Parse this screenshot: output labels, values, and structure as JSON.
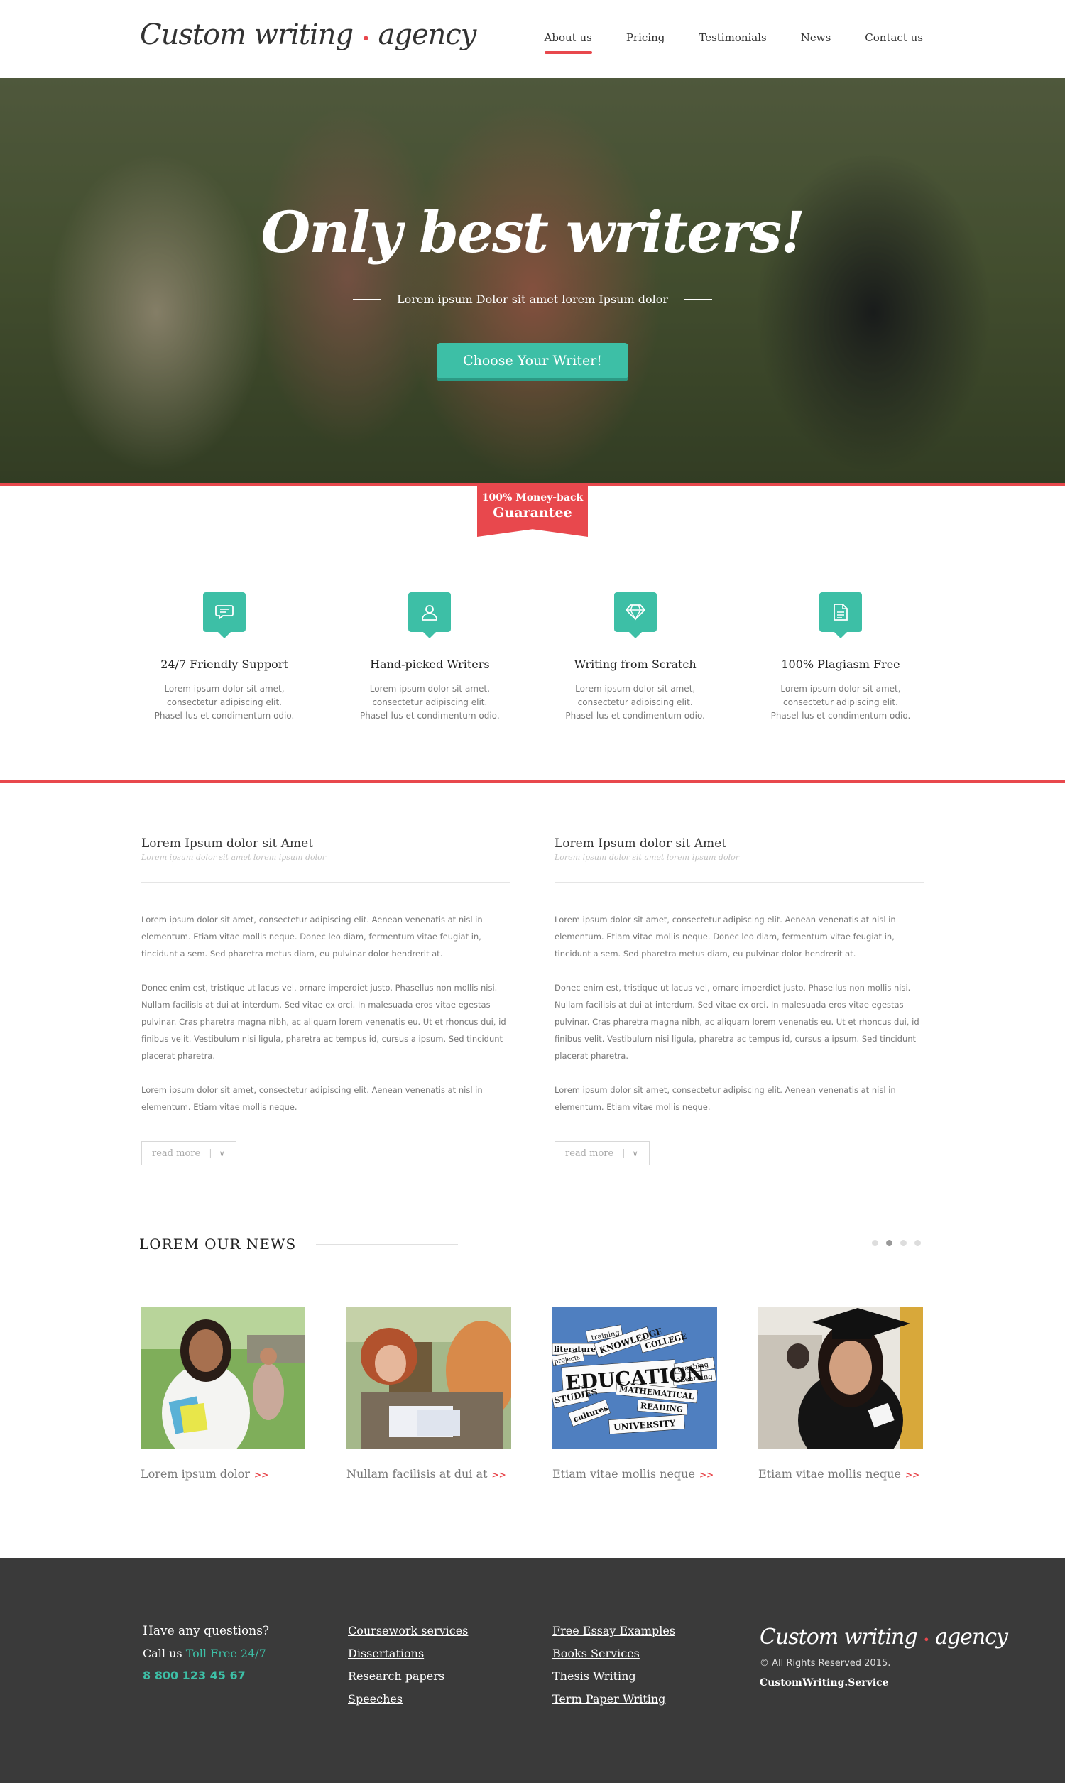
{
  "header": {
    "logo_main": "Custom writing",
    "logo_end": "agency",
    "nav": [
      {
        "label": "About us"
      },
      {
        "label": "Pricing"
      },
      {
        "label": "Testimonials"
      },
      {
        "label": "News"
      },
      {
        "label": "Contact us"
      }
    ]
  },
  "hero": {
    "title": "Only best writers!",
    "subtitle": "Lorem ipsum Dolor sit amet lorem Ipsum dolor",
    "cta": "Choose Your Writer!"
  },
  "ribbon": {
    "line1": "100% Money-back",
    "line2": "Guarantee"
  },
  "features": [
    {
      "icon": "chat-bubble-icon",
      "title": "24/7 Friendly Support",
      "desc": "Lorem ipsum dolor sit amet, consectetur adipiscing elit. Phasel-lus et condimentum odio."
    },
    {
      "icon": "user-icon",
      "title": "Hand-picked Writers",
      "desc": "Lorem ipsum dolor sit amet, consectetur adipiscing elit. Phasel-lus et condimentum odio."
    },
    {
      "icon": "diamond-icon",
      "title": "Writing from Scratch",
      "desc": "Lorem ipsum dolor sit amet, consectetur adipiscing elit. Phasel-lus et condimentum odio."
    },
    {
      "icon": "document-icon",
      "title": "100% Plagiasm Free",
      "desc": "Lorem ipsum dolor sit amet, consectetur adipiscing elit. Phasel-lus et condimentum odio."
    }
  ],
  "articles": [
    {
      "title": "Lorem Ipsum dolor sit Amet",
      "subtitle": "Lorem ipsum dolor sit amet lorem ipsum dolor",
      "paragraphs": [
        "Lorem ipsum dolor sit amet, consectetur adipiscing elit. Aenean venenatis at nisl in elementum. Etiam vitae mollis neque. Donec leo diam, fermentum vitae feugiat in, tincidunt a sem. Sed pharetra metus diam, eu pulvinar dolor hendrerit at.",
        "Donec enim est, tristique ut lacus vel, ornare imperdiet justo. Phasellus non mollis nisi. Nullam facilisis at dui at interdum. Sed vitae ex orci. In malesuada eros vitae egestas pulvinar. Cras pharetra magna nibh, ac aliquam lorem venenatis eu. Ut et rhoncus dui, id finibus velit. Vestibulum nisi ligula, pharetra ac tempus id, cursus a ipsum. Sed tincidunt placerat pharetra.",
        "Lorem ipsum dolor sit amet, consectetur adipiscing elit. Aenean venenatis at nisl in elementum. Etiam vitae mollis neque."
      ],
      "read_more": "read more"
    },
    {
      "title": "Lorem Ipsum dolor sit Amet",
      "subtitle": "Lorem ipsum dolor sit amet lorem ipsum dolor",
      "paragraphs": [
        "Lorem ipsum dolor sit amet, consectetur adipiscing elit. Aenean venenatis at nisl in elementum. Etiam vitae mollis neque. Donec leo diam, fermentum vitae feugiat in, tincidunt a sem. Sed pharetra metus diam, eu pulvinar dolor hendrerit at.",
        "Donec enim est, tristique ut lacus vel, ornare imperdiet justo. Phasellus non mollis nisi. Nullam facilisis at dui at interdum. Sed vitae ex orci. In malesuada eros vitae egestas pulvinar. Cras pharetra magna nibh, ac aliquam lorem venenatis eu. Ut et rhoncus dui, id finibus velit. Vestibulum nisi ligula, pharetra ac tempus id, cursus a ipsum. Sed tincidunt placerat pharetra.",
        "Lorem ipsum dolor sit amet, consectetur adipiscing elit. Aenean venenatis at nisl in elementum. Etiam vitae mollis neque."
      ],
      "read_more": "read more"
    }
  ],
  "news": {
    "heading": "LOREM OUR NEWS",
    "carousel_active_dot": 2,
    "carousel_dot_count": 4,
    "items": [
      {
        "caption": "Lorem ipsum dolor",
        "arrows": ">>"
      },
      {
        "caption": "Nullam facilisis at dui at",
        "arrows": ">>"
      },
      {
        "caption": "Etiam vitae mollis neque",
        "arrows": ">>"
      },
      {
        "caption": "Etiam vitae mollis neque",
        "arrows": ">>"
      }
    ],
    "education_words": [
      "training",
      "literature",
      "KNOWLEDGE",
      "COLLEGE",
      "projects",
      "EDUCATION",
      "teaching",
      "STUDIES",
      "MATHEMATICAL",
      "eLearning",
      "cultures",
      "READING",
      "UNIVERSITY"
    ]
  },
  "footer": {
    "question": "Have any questions?",
    "call_prefix": "Call us",
    "call_highlight": "Toll Free 24/7",
    "phone": "8 800 123 45 67",
    "links_col1": [
      "Coursework services",
      "Dissertations",
      "Research papers",
      "Speeches"
    ],
    "links_col2": [
      "Free Essay Examples",
      "Books Services",
      "Thesis Writing",
      "Term Paper Writing"
    ],
    "logo_main": "Custom writing",
    "logo_end": "agency",
    "copyright": "© All Rights Reserved 2015.",
    "brand": "CustomWriting.Service"
  },
  "colors": {
    "accent_red": "#e8484d",
    "accent_teal": "#3dbfa6",
    "footer_bg": "#3a3a3a"
  }
}
